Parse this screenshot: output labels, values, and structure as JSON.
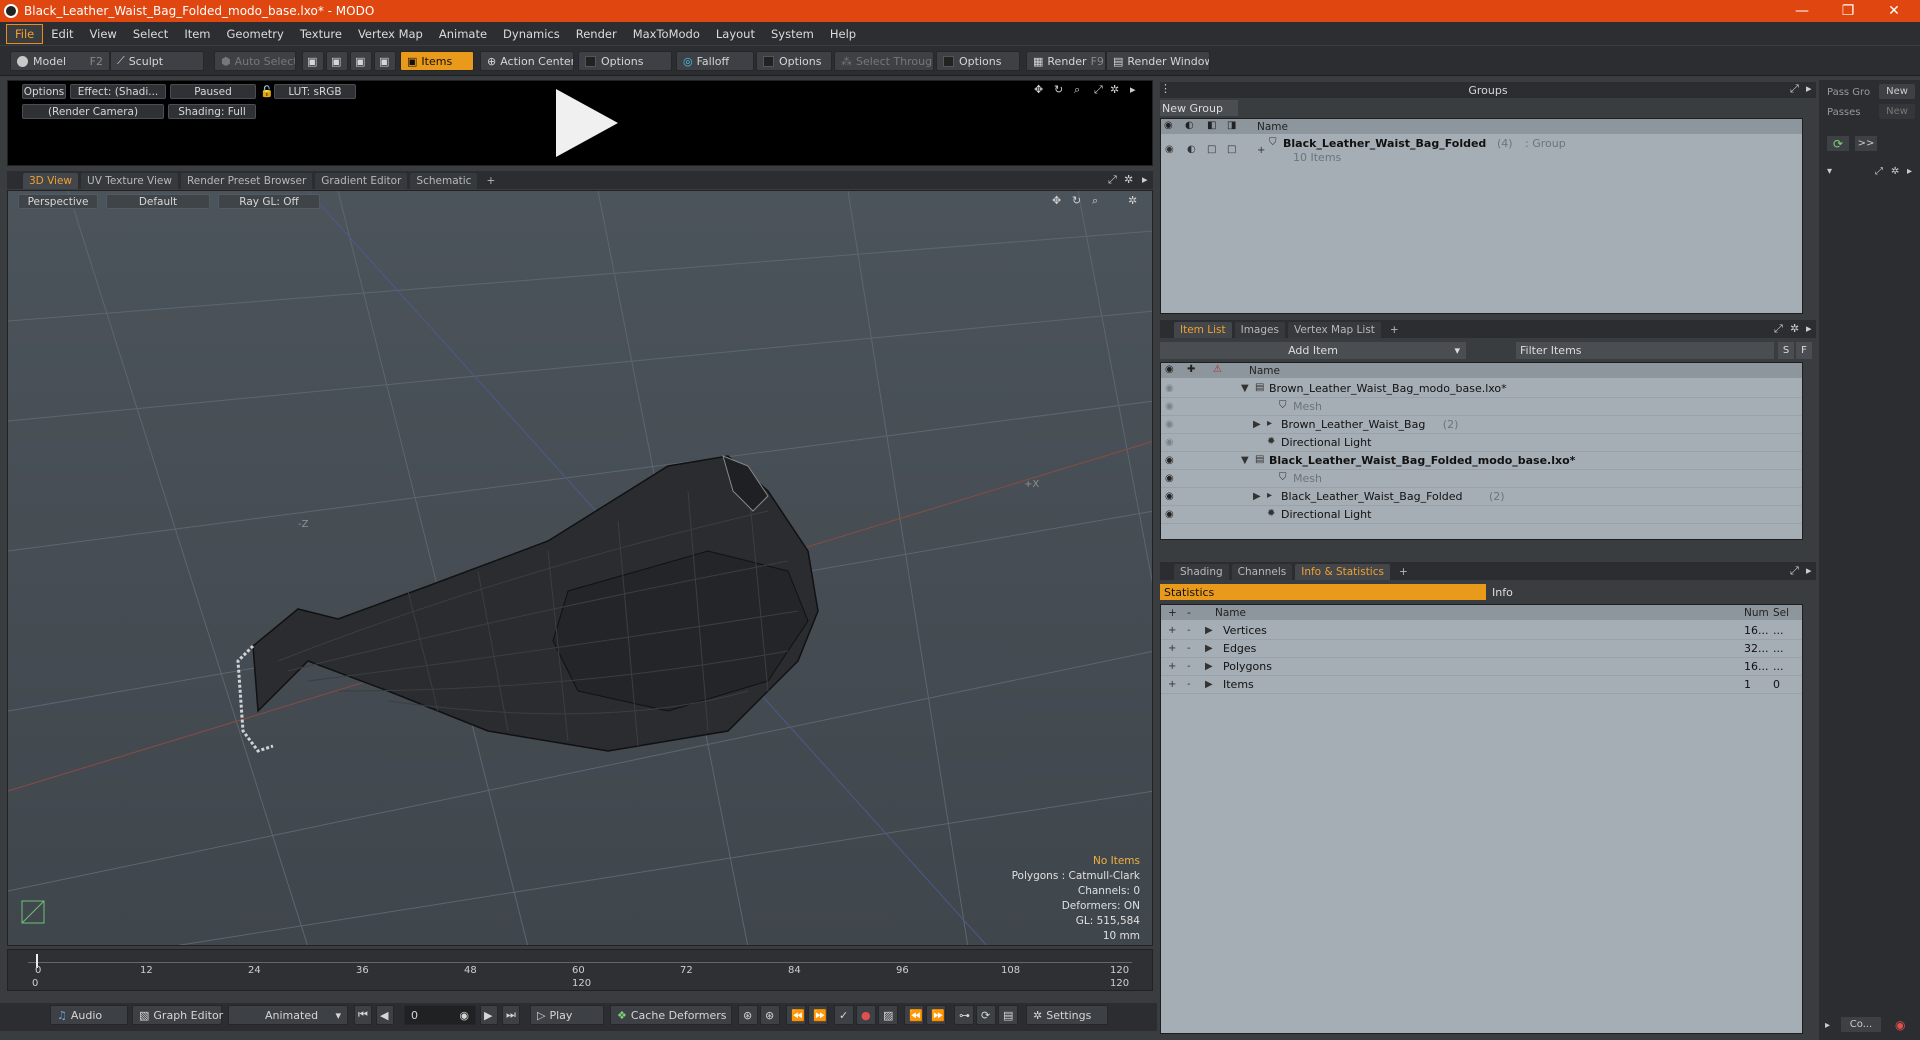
{
  "window": {
    "title": "Black_Leather_Waist_Bag_Folded_modo_base.lxo* - MODO",
    "minimize": "—",
    "restore": "❐",
    "close": "✕"
  },
  "menu": [
    "File",
    "Edit",
    "View",
    "Select",
    "Item",
    "Geometry",
    "Texture",
    "Vertex Map",
    "Animate",
    "Dynamics",
    "Render",
    "MaxToModo",
    "Layout",
    "System",
    "Help"
  ],
  "toolbar": {
    "model": "Model",
    "model_key": "F2",
    "sculpt": "Sculpt",
    "auto_select": "Auto Select",
    "items": "Items",
    "action_center": "Action Center",
    "options1": "Options",
    "falloff": "Falloff",
    "options2": "Options",
    "select_through": "Select Through",
    "options3": "Options",
    "render": "Render",
    "render_key": "F9",
    "render_window": "Render Window"
  },
  "preview": {
    "options": "Options",
    "effect": "Effect: (Shadi...",
    "paused": "Paused",
    "lut": "LUT: sRGB",
    "camera": "(Render Camera)",
    "shading": "Shading: Full"
  },
  "viewport_tabs": [
    "3D View",
    "UV Texture View",
    "Render Preset Browser",
    "Gradient Editor",
    "Schematic",
    "+"
  ],
  "viewport": {
    "perspective": "Perspective",
    "default": "Default",
    "raygl": "Ray GL: Off",
    "axis_x": "+X",
    "axis_z": "-Z",
    "no_items": "No Items",
    "polygons": "Polygons : Catmull-Clark",
    "channels": "Channels: 0",
    "deformers": "Deformers: ON",
    "gl": "GL: 515,584",
    "scale": "10 mm"
  },
  "timeline": {
    "ticks": [
      "0",
      "12",
      "24",
      "36",
      "48",
      "60",
      "72",
      "84",
      "96",
      "108",
      "120"
    ],
    "start": "0",
    "mid": "120",
    "end": "120"
  },
  "transport": {
    "audio": "Audio",
    "graph_editor": "Graph Editor",
    "animated": "Animated",
    "frame": "0",
    "play": "Play",
    "cache_deformers": "Cache Deformers",
    "settings": "Settings"
  },
  "groups": {
    "header": "Groups",
    "new_group": "New Group",
    "col_name": "Name",
    "group_name": "Black_Leather_Waist_Bag_Folded",
    "group_count": "(4)",
    "group_type": ": Group",
    "group_items": "10 Items"
  },
  "pass": {
    "pass_groups": "Pass Gro",
    "new1": "New",
    "passes": "Passes",
    "new2": "New",
    "arrows": ">>"
  },
  "itemlist": {
    "tabs": [
      "Item List",
      "Images",
      "Vertex Map List",
      "+"
    ],
    "add_item": "Add Item",
    "filter": "Filter Items",
    "s": "S",
    "f": "F",
    "col_name": "Name",
    "rows": [
      {
        "name": "Brown_Leather_Waist_Bag_modo_base.lxo*",
        "count": "",
        "bold": false,
        "gray": false,
        "indent": 0,
        "expand": "▼",
        "eye": false
      },
      {
        "name": "Mesh",
        "count": "",
        "bold": false,
        "gray": true,
        "indent": 2,
        "expand": "",
        "eye": false
      },
      {
        "name": "Brown_Leather_Waist_Bag",
        "count": "(2)",
        "bold": false,
        "gray": false,
        "indent": 1,
        "expand": "▶",
        "eye": false
      },
      {
        "name": "Directional Light",
        "count": "",
        "bold": false,
        "gray": false,
        "indent": 1,
        "expand": "",
        "eye": false
      },
      {
        "name": "Black_Leather_Waist_Bag_Folded_modo_base.lxo*",
        "count": "",
        "bold": true,
        "gray": false,
        "indent": 0,
        "expand": "▼",
        "eye": true
      },
      {
        "name": "Mesh",
        "count": "",
        "bold": false,
        "gray": true,
        "indent": 2,
        "expand": "",
        "eye": true
      },
      {
        "name": "Black_Leather_Waist_Bag_Folded",
        "count": "(2)",
        "bold": false,
        "gray": false,
        "indent": 1,
        "expand": "▶",
        "eye": true
      },
      {
        "name": "Directional Light",
        "count": "",
        "bold": false,
        "gray": false,
        "indent": 1,
        "expand": "",
        "eye": true
      }
    ]
  },
  "stats": {
    "tabs": [
      "Shading",
      "Channels",
      "Info & Statistics",
      "+"
    ],
    "statistics": "Statistics",
    "info": "Info",
    "col_name": "Name",
    "col_num": "Num",
    "col_sel": "Sel",
    "rows": [
      {
        "name": "Vertices",
        "num": "16...",
        "sel": "..."
      },
      {
        "name": "Edges",
        "num": "32...",
        "sel": "..."
      },
      {
        "name": "Polygons",
        "num": "16...",
        "sel": "..."
      },
      {
        "name": "Items",
        "num": "1",
        "sel": "0"
      }
    ]
  },
  "bottom_right": {
    "co": "Co..."
  },
  "colors": {
    "accent": "#e99a1a",
    "title_bar": "#e0460f"
  }
}
